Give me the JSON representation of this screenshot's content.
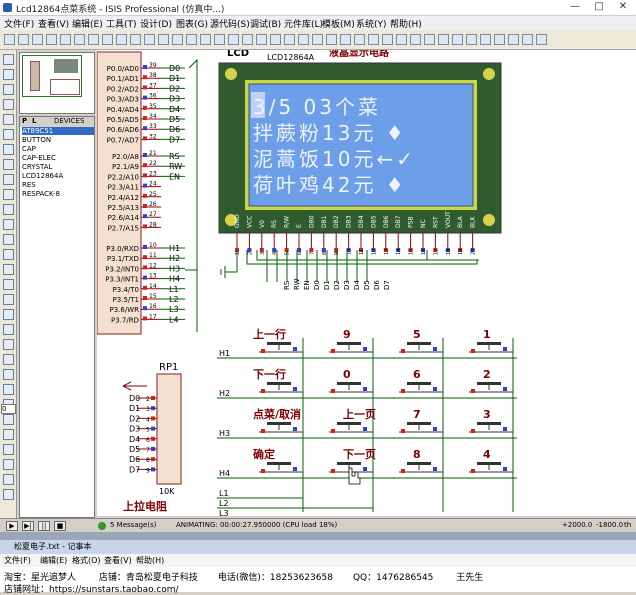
{
  "window": {
    "title": "Lcd12864点菜系统 - ISIS Professional (仿真中...)",
    "minimize": "—",
    "maximize": "□",
    "close": "✕"
  },
  "menu": [
    "文件(F)",
    "查看(V)",
    "编辑(E)",
    "工具(T)",
    "设计(D)",
    "图表(G)",
    "源代码(S)",
    "调试(B)",
    "元件库(L)",
    "模板(M)",
    "系统(Y)",
    "帮助(H)"
  ],
  "device_panel": {
    "tab_p": "P",
    "tab_l": "L",
    "header": "DEVICES",
    "devices": [
      "AT89C51",
      "BUTTON",
      "CAP",
      "CAP-ELEC",
      "CRYSTAL",
      "LCD12864A",
      "RES",
      "RESPACK-8"
    ],
    "rotation": "0"
  },
  "lcd": {
    "label": "LCD",
    "part": "LCD12864A",
    "caption": "液晶显示电路",
    "rows": [
      "3/5  03个菜",
      "拌蕨粉13元 ♦",
      "泥蒿饭10元←✓",
      "荷叶鸡42元 ♦"
    ],
    "pin_names": [
      "GND",
      "VCC",
      "V0",
      "RS",
      "R/W",
      "E",
      "DB0",
      "DB1",
      "DB2",
      "DB3",
      "DB4",
      "DB5",
      "DB6",
      "DB7",
      "PSB",
      "NC",
      "RST",
      "VOUT",
      "BLA",
      "BLK"
    ],
    "pin_nums": [
      "1",
      "2",
      "3",
      "4",
      "5",
      "6",
      "7",
      "8",
      "9",
      "10",
      "11",
      "12",
      "13",
      "14",
      "15",
      "16",
      "17",
      "18",
      "19",
      "20"
    ],
    "bus_labels": [
      "RS",
      "RW",
      "EN",
      "D0",
      "D1",
      "D2",
      "D3",
      "D4",
      "D5",
      "D6",
      "D7"
    ]
  },
  "mcu": {
    "port0": [
      {
        "pin": "P0.0/AD0",
        "num": "39",
        "net": "D0"
      },
      {
        "pin": "P0.1/AD1",
        "num": "38",
        "net": "D1"
      },
      {
        "pin": "P0.2/AD2",
        "num": "37",
        "net": "D2"
      },
      {
        "pin": "P0.3/AD3",
        "num": "36",
        "net": "D3"
      },
      {
        "pin": "P0.4/AD4",
        "num": "35",
        "net": "D4"
      },
      {
        "pin": "P0.5/AD5",
        "num": "34",
        "net": "D5"
      },
      {
        "pin": "P0.6/AD6",
        "num": "33",
        "net": "D6"
      },
      {
        "pin": "P0.7/AD7",
        "num": "32",
        "net": "D7"
      }
    ],
    "port2": [
      {
        "pin": "P2.0/A8",
        "num": "21",
        "net": "RS"
      },
      {
        "pin": "P2.1/A9",
        "num": "22",
        "net": "RW"
      },
      {
        "pin": "P2.2/A10",
        "num": "23",
        "net": "EN"
      },
      {
        "pin": "P2.3/A11",
        "num": "24",
        "net": ""
      },
      {
        "pin": "P2.4/A12",
        "num": "25",
        "net": ""
      },
      {
        "pin": "P2.5/A13",
        "num": "26",
        "net": ""
      },
      {
        "pin": "P2.6/A14",
        "num": "27",
        "net": ""
      },
      {
        "pin": "P2.7/A15",
        "num": "28",
        "net": ""
      }
    ],
    "port3": [
      {
        "pin": "P3.0/RXD",
        "num": "10",
        "net": "H1"
      },
      {
        "pin": "P3.1/TXD",
        "num": "11",
        "net": "H2"
      },
      {
        "pin": "P3.2/INT0",
        "num": "12",
        "net": "H3"
      },
      {
        "pin": "P3.3/INT1",
        "num": "13",
        "net": "H4"
      },
      {
        "pin": "P3.4/T0",
        "num": "14",
        "net": "L1"
      },
      {
        "pin": "P3.5/T1",
        "num": "15",
        "net": "L2"
      },
      {
        "pin": "P3.6/WR",
        "num": "16",
        "net": "L3"
      },
      {
        "pin": "P3.7/RD",
        "num": "17",
        "net": "L4"
      }
    ]
  },
  "respack": {
    "name": "RP1",
    "value": "10K",
    "caption": "上拉电阻",
    "pins": [
      {
        "net": "D0",
        "num": "2"
      },
      {
        "net": "D1",
        "num": "3"
      },
      {
        "net": "D2",
        "num": "4"
      },
      {
        "net": "D3",
        "num": "5"
      },
      {
        "net": "D4",
        "num": "6"
      },
      {
        "net": "D5",
        "num": "7"
      },
      {
        "net": "D6",
        "num": "8"
      },
      {
        "net": "D7",
        "num": "9"
      }
    ]
  },
  "keypad": {
    "row_nets": [
      "H1",
      "H2",
      "H3",
      "H4"
    ],
    "col_nets": [
      "L1",
      "L2",
      "L3"
    ],
    "keys": [
      [
        "上一行",
        "9",
        "5",
        "1"
      ],
      [
        "下一行",
        "0",
        "6",
        "2"
      ],
      [
        "点菜/取消",
        "上一页",
        "7",
        "3"
      ],
      [
        "确定",
        "下一页",
        "8",
        "4"
      ]
    ]
  },
  "status": {
    "messages": "5 Message(s)",
    "animating": "ANIMATING: 00:00:27.950000 (CPU load 18%)",
    "coord_x": "+2000.0",
    "coord_y": "-1800.0",
    "unit": "th"
  },
  "notepad": {
    "title": "松夏电子.txt - 记事本",
    "menu": [
      "文件(F)",
      "编辑(E)",
      "格式(O)",
      "查看(V)",
      "帮助(H)"
    ],
    "line1": "淘宝：星光追梦人        店铺：青岛松夏电子科技       电话(微信)：18253623658       QQ：1476286545        王先生",
    "line2": "店铺网址：https://sunstars.taobao.com/"
  }
}
